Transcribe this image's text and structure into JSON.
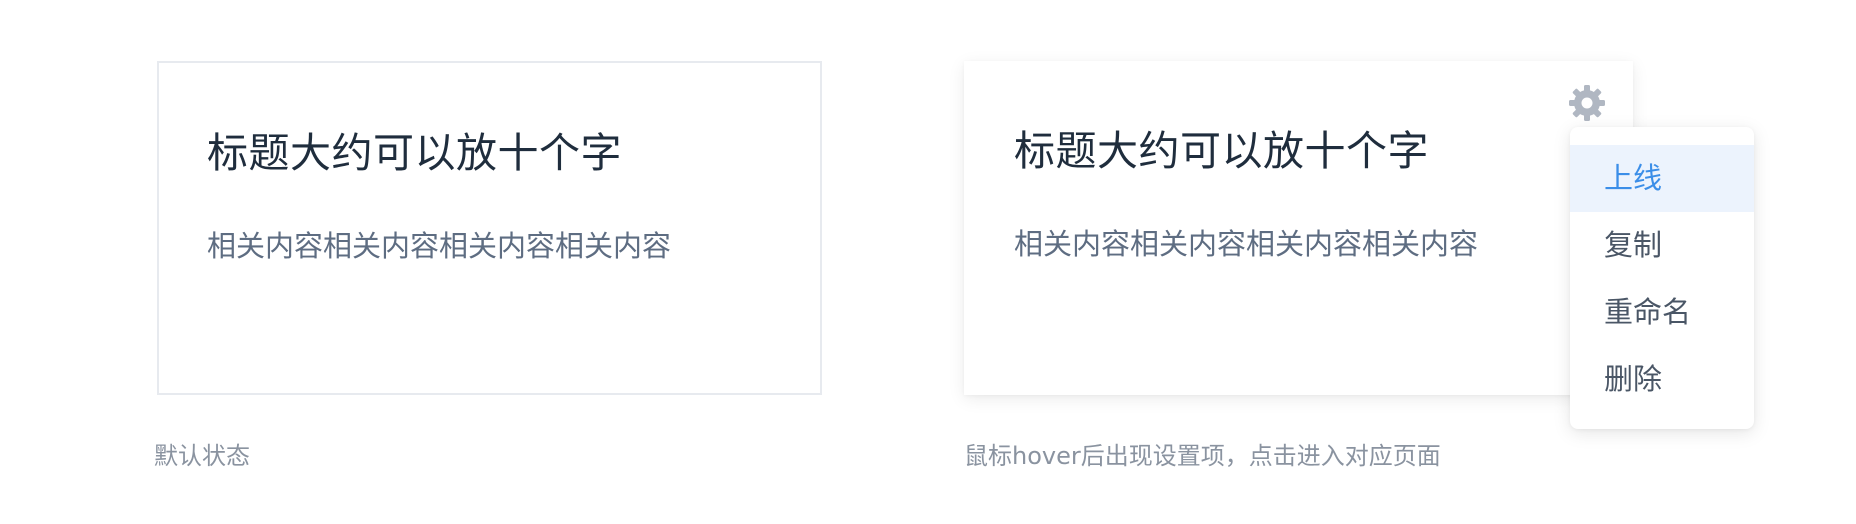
{
  "cards": [
    {
      "title": "标题大约可以放十个字",
      "description": "相关内容相关内容相关内容相关内容",
      "caption": "默认状态"
    },
    {
      "title": "标题大约可以放十个字",
      "description": "相关内容相关内容相关内容相关内容",
      "caption": "鼠标hover后出现设置项，点击进入对应页面",
      "settings_icon": "gear-icon",
      "menu": {
        "items": [
          {
            "label": "上线",
            "active": true
          },
          {
            "label": "复制",
            "active": false
          },
          {
            "label": "重命名",
            "active": false
          },
          {
            "label": "删除",
            "active": false
          }
        ]
      }
    }
  ],
  "colors": {
    "accent": "#3b8ee8",
    "active_bg": "#ecf3fd",
    "title": "#1f2d3d",
    "text": "#5e6d82",
    "caption": "#8a93a0",
    "icon": "#b0b7c2"
  }
}
